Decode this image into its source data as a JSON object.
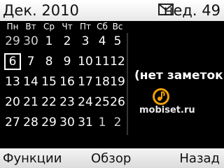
{
  "header": {
    "month": "Дек. 2010",
    "week": "нед. 49",
    "message_icon": "envelope-icon"
  },
  "weekdays": [
    "Пн",
    "Вт",
    "Ср",
    "Чт",
    "Пт",
    "Сб",
    "Вс"
  ],
  "weeks": [
    [
      {
        "d": "29",
        "other": true
      },
      {
        "d": "30",
        "other": true
      },
      {
        "d": "1"
      },
      {
        "d": "2"
      },
      {
        "d": "3"
      },
      {
        "d": "4"
      },
      {
        "d": "5"
      }
    ],
    [
      {
        "d": "6",
        "today": true
      },
      {
        "d": "7"
      },
      {
        "d": "8"
      },
      {
        "d": "9"
      },
      {
        "d": "10"
      },
      {
        "d": "11"
      },
      {
        "d": "12"
      }
    ],
    [
      {
        "d": "13"
      },
      {
        "d": "14"
      },
      {
        "d": "15"
      },
      {
        "d": "16"
      },
      {
        "d": "17"
      },
      {
        "d": "18"
      },
      {
        "d": "19"
      }
    ],
    [
      {
        "d": "20"
      },
      {
        "d": "21"
      },
      {
        "d": "22"
      },
      {
        "d": "23"
      },
      {
        "d": "24"
      },
      {
        "d": "25"
      },
      {
        "d": "26"
      }
    ],
    [
      {
        "d": "27"
      },
      {
        "d": "28"
      },
      {
        "d": "29"
      },
      {
        "d": "30"
      },
      {
        "d": "31"
      },
      {
        "d": "1",
        "other": true
      },
      {
        "d": "2",
        "other": true
      }
    ]
  ],
  "notes": "(нет заметок)",
  "watermark": {
    "text": "mobiset.ru",
    "logo_color": "#f0a000"
  },
  "softkeys": {
    "left": "Функции",
    "center": "Обзор",
    "right": "Назад"
  }
}
